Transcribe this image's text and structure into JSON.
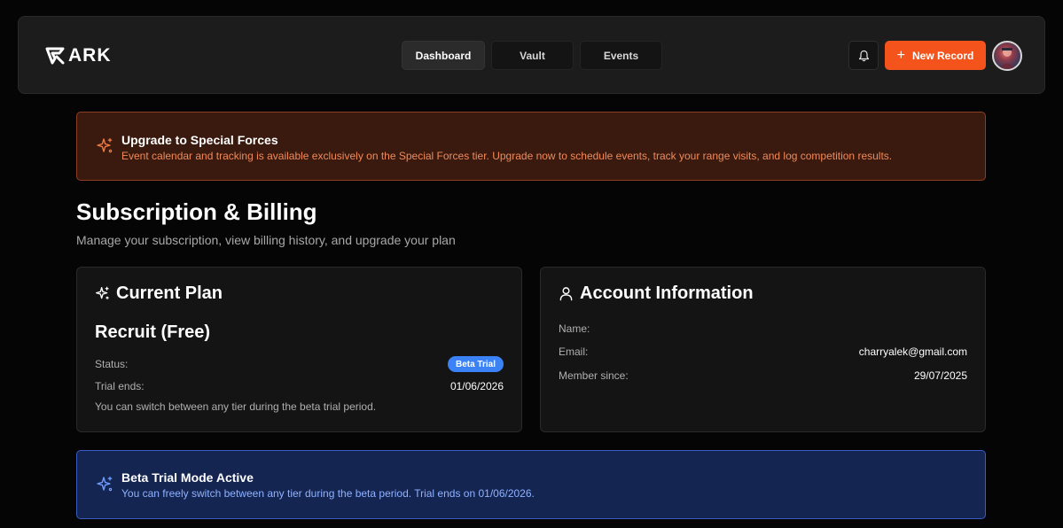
{
  "brand": {
    "name": "ARK"
  },
  "nav": {
    "tabs": [
      {
        "label": "Dashboard",
        "active": true
      },
      {
        "label": "Vault",
        "active": false
      },
      {
        "label": "Events",
        "active": false
      }
    ]
  },
  "header": {
    "notification_icon": "bell-icon",
    "new_record_label": "New Record",
    "new_record_icon": "plus-icon",
    "accent_color": "#f4531c"
  },
  "upgrade_banner": {
    "icon": "sparkles-icon",
    "title": "Upgrade to Special Forces",
    "text": "Event calendar and tracking is available exclusively on the Special Forces tier. Upgrade now to schedule events, track your range visits, and log competition results."
  },
  "page": {
    "title": "Subscription & Billing",
    "subtitle": "Manage your subscription, view billing history, and upgrade your plan"
  },
  "current_plan": {
    "heading": "Current Plan",
    "icon": "sparkles-icon",
    "plan_name": "Recruit (Free)",
    "status_label": "Status:",
    "status_badge": "Beta Trial",
    "trial_ends_label": "Trial ends:",
    "trial_ends_value": "01/06/2026",
    "note": "You can switch between any tier during the beta trial period."
  },
  "account": {
    "heading": "Account Information",
    "icon": "user-icon",
    "name_label": "Name:",
    "name_value": "",
    "email_label": "Email:",
    "email_value": "charryalek@gmail.com",
    "member_since_label": "Member since:",
    "member_since_value": "29/07/2025"
  },
  "beta_banner": {
    "icon": "sparkles-icon",
    "title": "Beta Trial Mode Active",
    "text": "You can freely switch between any tier during the beta period. Trial ends on 01/06/2026."
  }
}
